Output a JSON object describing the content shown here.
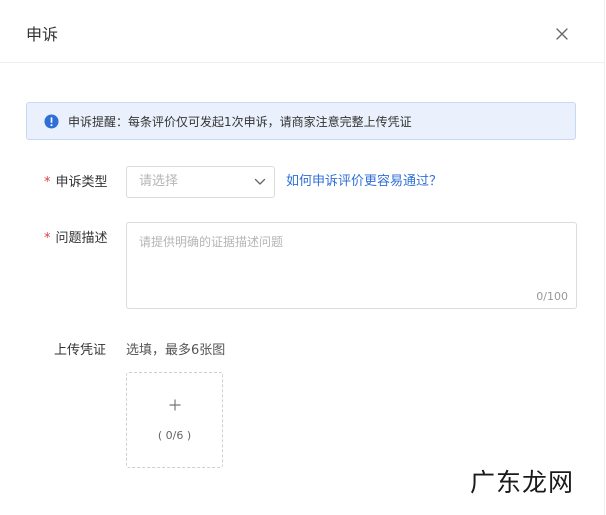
{
  "dialog": {
    "title": "申诉",
    "close_icon": "close-icon"
  },
  "alert": {
    "icon": "info-icon",
    "text": "申诉提醒：每条评价仅可发起1次申诉，请商家注意完整上传凭证"
  },
  "form": {
    "type": {
      "required_mark": "*",
      "label": "申诉类型",
      "placeholder": "请选择",
      "icon": "chevron-down-icon"
    },
    "help_link": "如何申诉评价更容易通过？",
    "description": {
      "required_mark": "*",
      "label": "问题描述",
      "placeholder": "请提供明确的证据描述问题",
      "counter": "0/100"
    },
    "upload": {
      "label": "上传凭证",
      "hint": "选填，最多6张图",
      "icon": "plus-icon",
      "count": "( 0/6 )"
    }
  },
  "watermark": "广东龙网",
  "colors": {
    "accent": "#2f6fd6",
    "required": "#e4393c",
    "alert_bg": "#eaf1fc",
    "alert_border": "#c8d9f5"
  }
}
